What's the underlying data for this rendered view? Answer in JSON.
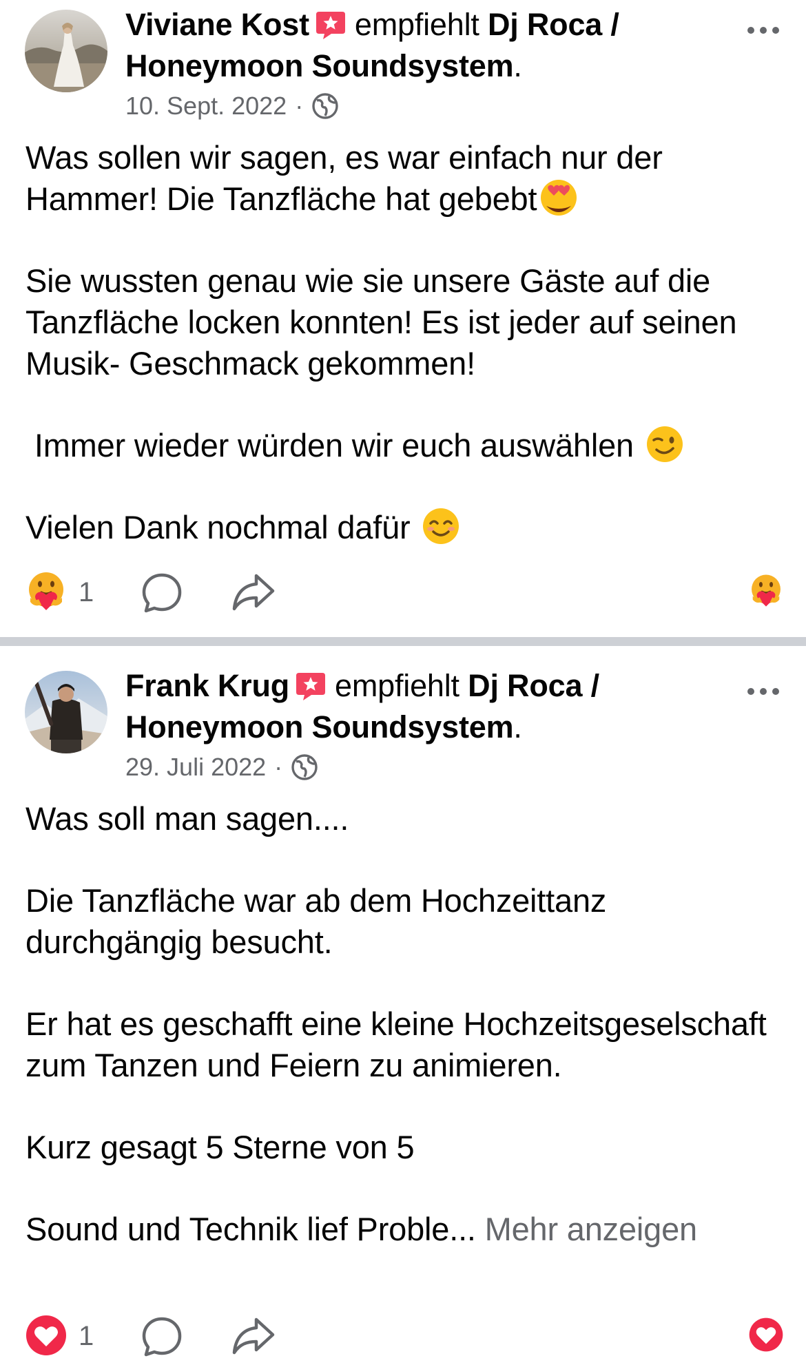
{
  "posts": [
    {
      "author": "Viviane Kost",
      "verb": "empfiehlt",
      "page": "Dj Roca / Honeymoon Soundsystem",
      "period": ".",
      "date": "10. Sept. 2022",
      "separator": "·",
      "audience_icon": "globe-icon",
      "paragraphs": [
        {
          "text": "Was sollen wir sagen, es war einfach nur der Hammer! Die Tanzfläche hat gebebt",
          "emoji": "heart-eyes-emoji"
        },
        {
          "text": "Sie wussten genau wie sie unsere Gäste auf die Tanzfläche locken konnten! Es ist jeder auf seinen Musik- Geschmack gekommen!"
        },
        {
          "text": " Immer wieder würden wir euch auswählen ",
          "emoji": "wink-emoji"
        },
        {
          "text": "Vielen Dank nochmal dafür ",
          "emoji": "smile-emoji"
        }
      ],
      "reaction": {
        "icon": "care-reaction-icon",
        "count": "1"
      },
      "my_reaction_icon": "care-reaction-icon"
    },
    {
      "author": "Frank Krug",
      "verb": "empfiehlt",
      "page": "Dj Roca / Honeymoon Soundsystem",
      "period": ".",
      "date": "29. Juli 2022",
      "separator": "·",
      "audience_icon": "globe-icon",
      "paragraphs": [
        {
          "text": "Was soll man sagen...."
        },
        {
          "text": "Die Tanzfläche war ab dem Hochzeittanz durchgängig besucht."
        },
        {
          "text": "Er hat es geschafft eine kleine Hochzeitsgeselschaft zum Tanzen und Feiern zu animieren."
        },
        {
          "text": "Kurz gesagt 5 Sterne von 5"
        },
        {
          "text": "Sound und Technik lief Proble... ",
          "more": "Mehr anzeigen"
        }
      ],
      "reaction": {
        "icon": "love-reaction-icon",
        "count": "1"
      },
      "my_reaction_icon": "love-reaction-icon"
    }
  ],
  "colors": {
    "text": "#050505",
    "secondary": "#65676b",
    "badge": "#f3425f",
    "divider": "#cdd0d5",
    "love": "#f02849",
    "care_face": "#f7b125"
  }
}
